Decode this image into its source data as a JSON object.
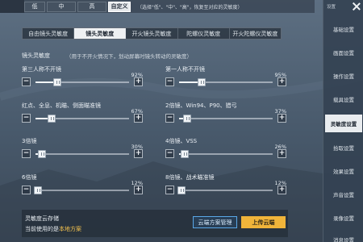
{
  "mode_bar": {
    "modes": [
      "低",
      "中",
      "高",
      "自定义"
    ],
    "selected": "自定义",
    "hint": "（选择\"低\"、\"中\"、\"高\"，恢复至对应的灵敏度）"
  },
  "tabs": [
    {
      "label": "自由镜头灵敏度",
      "active": false
    },
    {
      "label": "镜头灵敏度",
      "active": true
    },
    {
      "label": "开火镜头灵敏度",
      "active": false
    },
    {
      "label": "陀螺仪灵敏度",
      "active": false
    },
    {
      "label": "开火陀螺仪灵敏度",
      "active": false
    }
  ],
  "section": {
    "title": "镜头灵敏度",
    "description": "（用于不开火情况下，划动屏幕时镜头转动的灵敏度）"
  },
  "sliders": [
    {
      "label": "第三人称不开镜",
      "percent": "92%",
      "value": 0.23
    },
    {
      "label": "第一人称不开镜",
      "percent": "95%",
      "value": 0.24
    },
    {
      "label": "红点、全息、机瞄、侧面瞄准镜",
      "percent": "67%",
      "value": 0.17
    },
    {
      "label": "2倍镜、Win94、P90、猎弓",
      "percent": "37%",
      "value": 0.09
    },
    {
      "label": "3倍镜",
      "percent": "30%",
      "value": 0.07
    },
    {
      "label": "4倍镜、VSS",
      "percent": "26%",
      "value": 0.06
    },
    {
      "label": "6倍镜",
      "percent": "12%",
      "value": 0.03
    },
    {
      "label": "8倍镜、战术瞄准镜",
      "percent": "12%",
      "value": 0.03
    }
  ],
  "cloud": {
    "title": "灵敏度云存储",
    "current_prefix": "当前使用的是",
    "current_plan": "本地方案",
    "manage_label": "云端方案管理",
    "upload_label": "上传云端"
  },
  "sidebar": {
    "header": "设置",
    "items": [
      {
        "label": "基础设置",
        "active": false
      },
      {
        "label": "画面设置",
        "active": false
      },
      {
        "label": "操作设置",
        "active": false
      },
      {
        "label": "载具设置",
        "active": false
      },
      {
        "label": "灵敏度设置",
        "active": true
      },
      {
        "label": "拾取设置",
        "active": false
      },
      {
        "label": "效果设置",
        "active": false
      },
      {
        "label": "声音设置",
        "active": false
      },
      {
        "label": "录像设置",
        "active": false
      },
      {
        "label": "消息设置",
        "active": false
      }
    ]
  },
  "colors": {
    "accent_upload": "#f0b43a",
    "cloud_manage_border": "#5aa8e8",
    "highlight_text": "#f2c14e"
  }
}
